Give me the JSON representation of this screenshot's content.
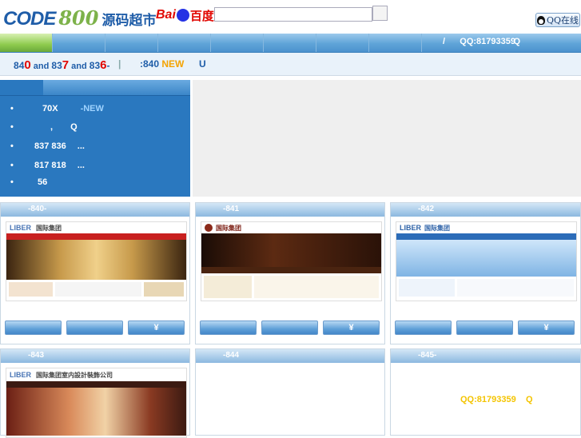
{
  "header": {
    "logo_code": "CODE",
    "logo_num": "800",
    "logo_cn": "源码超市",
    "baidu_a": "Bai",
    "baidu_b": "百度",
    "search_placeholder": "",
    "qq_online": "QQ在线"
  },
  "nav": {
    "items": [
      "",
      "",
      "",
      "",
      "",
      "",
      "",
      ""
    ],
    "slash": "/",
    "qq": "QQ:81793359",
    "qq_suffix": "Q"
  },
  "subbar": {
    "part1": [
      "8",
      "4",
      "0",
      " and ",
      "8",
      "3",
      "7",
      " and ",
      "8",
      "3",
      "6",
      "-"
    ],
    "sep": "|",
    "part2": ":840 ",
    "new_label": "NEW",
    "part3": "U"
  },
  "left_panel": {
    "items": [
      {
        "text": "70X",
        "badge": "-NEW"
      },
      {
        "text": ",",
        "badge": "Q"
      },
      {
        "text": "837 836",
        "badge": "..."
      },
      {
        "text": "817 818",
        "badge": "..."
      },
      {
        "text": "56",
        "badge": ""
      }
    ]
  },
  "cards": [
    {
      "label": "-840-",
      "site_title": "国际集团",
      "buttons": [
        "",
        "",
        "¥"
      ]
    },
    {
      "label": "-841",
      "site_title": "国际集团",
      "buttons": [
        "",
        "",
        "¥"
      ]
    },
    {
      "label": "-842",
      "site_title": "国际集团",
      "buttons": [
        "",
        "",
        "¥"
      ]
    },
    {
      "label": "-843",
      "site_title": "国际集团室内設計裝飾公司",
      "buttons": []
    },
    {
      "label": "-844",
      "site_title": "",
      "buttons": []
    },
    {
      "label": "-845-",
      "site_title": "",
      "buttons": []
    }
  ],
  "float_qq": "QQ:81793359    Q",
  "colors": {
    "brand_blue": "#1f5da8",
    "green": "#7db24a",
    "panel_blue": "#2a78bf",
    "red": "#e10601"
  }
}
